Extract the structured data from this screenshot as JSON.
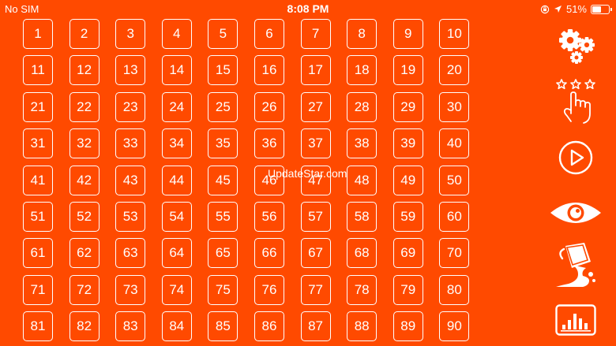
{
  "status_bar": {
    "carrier": "No SIM",
    "time": "8:08 PM",
    "battery": "51%",
    "battery_level": 0.51
  },
  "level_grid": {
    "levels": [
      "1",
      "2",
      "3",
      "4",
      "5",
      "6",
      "7",
      "8",
      "9",
      "10",
      "11",
      "12",
      "13",
      "14",
      "15",
      "16",
      "17",
      "18",
      "19",
      "20",
      "21",
      "22",
      "23",
      "24",
      "25",
      "26",
      "27",
      "28",
      "29",
      "30",
      "31",
      "32",
      "33",
      "34",
      "35",
      "36",
      "37",
      "38",
      "39",
      "40",
      "41",
      "42",
      "43",
      "44",
      "45",
      "46",
      "47",
      "48",
      "49",
      "50",
      "51",
      "52",
      "53",
      "54",
      "55",
      "56",
      "57",
      "58",
      "59",
      "60",
      "61",
      "62",
      "63",
      "64",
      "65",
      "66",
      "67",
      "68",
      "69",
      "70",
      "71",
      "72",
      "73",
      "74",
      "75",
      "76",
      "77",
      "78",
      "79",
      "80",
      "81",
      "82",
      "83",
      "84",
      "85",
      "86",
      "87",
      "88",
      "89",
      "90"
    ]
  },
  "watermark": "UpdateStar.com",
  "sidebar": {
    "buttons": [
      {
        "name": "settings-button",
        "icon": "gears-icon"
      },
      {
        "name": "rate-button",
        "icon": "stars-hand-icon"
      },
      {
        "name": "play-button",
        "icon": "play-icon"
      },
      {
        "name": "view-button",
        "icon": "eye-icon"
      },
      {
        "name": "paint-button",
        "icon": "paint-bucket-icon"
      },
      {
        "name": "stats-button",
        "icon": "bar-chart-icon"
      }
    ]
  },
  "colors": {
    "background": "#ff4a00",
    "foreground": "#ffffff"
  }
}
